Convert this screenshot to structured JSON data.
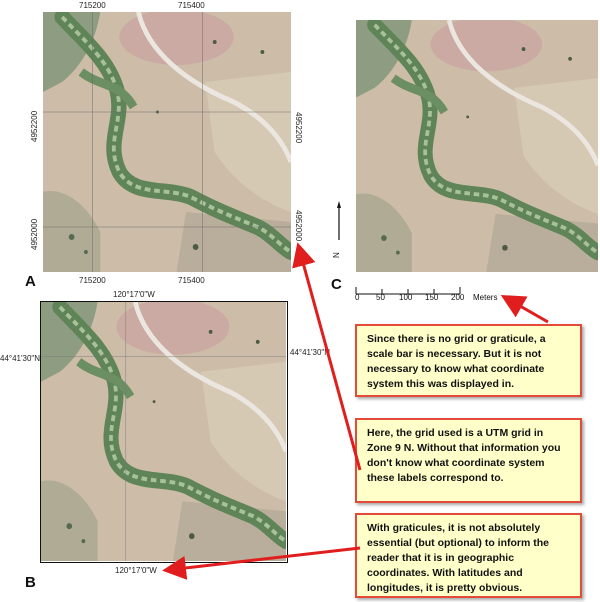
{
  "panels": {
    "a": {
      "letter": "A",
      "top_labels": [
        "715200",
        "715400"
      ],
      "bottom_labels": [
        "715200",
        "715400"
      ],
      "left_labels": [
        "4952200",
        "4952000"
      ],
      "right_labels": [
        "4952200",
        "4952000"
      ]
    },
    "b": {
      "letter": "B",
      "top_label": "120°17'0\"W",
      "bottom_label": "120°17'0\"W",
      "left_label": "44°41'30\"N",
      "right_label": "44°41'30\"N"
    },
    "c": {
      "letter": "C",
      "north": "N"
    }
  },
  "scale_bar": {
    "ticks": [
      "0",
      "50",
      "100",
      "150",
      "200"
    ],
    "unit": "Meters"
  },
  "notes": [
    "Since there is no grid or graticule, a scale bar is necessary. But it is not necessary to know what coordinate system this was displayed in.",
    "Here, the grid used is a UTM grid in Zone 9 N. Without that information you don't know what coordinate system these labels correspond to.",
    "With graticules, it is not absolutely essential (but optional) to inform the reader that it is in geographic coordinates. With latitudes and longitudes, it is pretty obvious."
  ],
  "colors": {
    "note_bg": "#ffffc9",
    "note_border": "#e24a3a",
    "arrow": "#e01e1e",
    "terrain": "#c9b8a2",
    "riparian": "#6f8f6a"
  }
}
